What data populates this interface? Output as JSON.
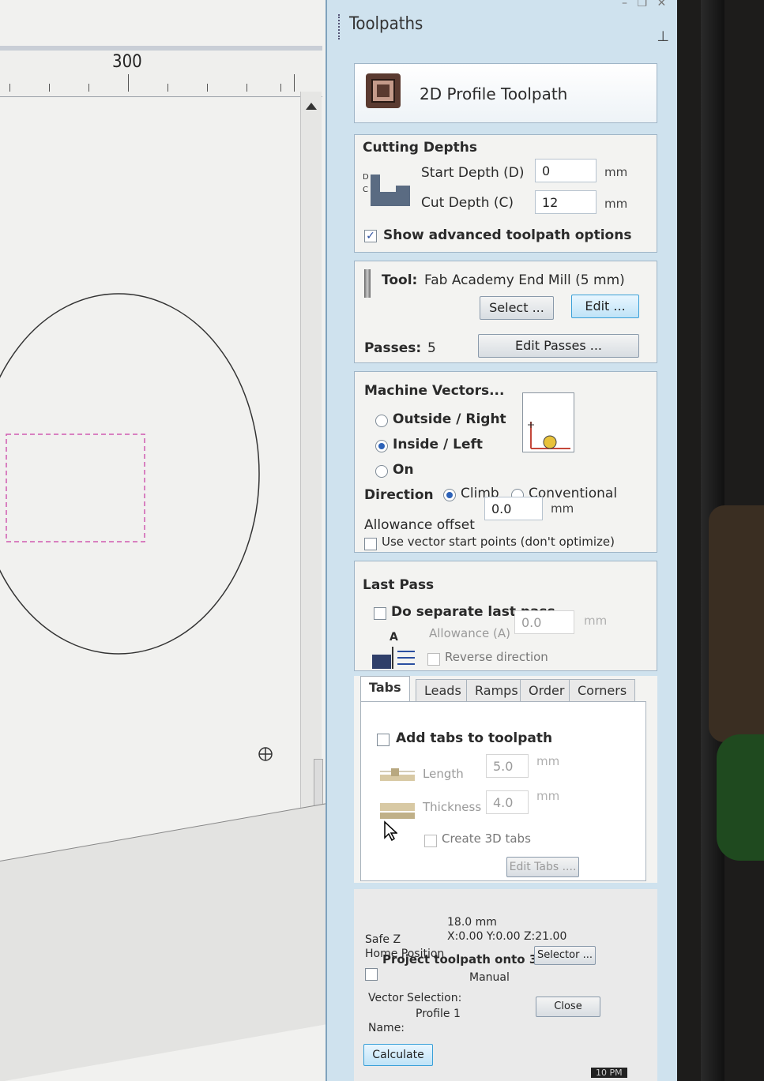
{
  "window": {
    "minimize": "–",
    "restore": "❐",
    "close": "✕"
  },
  "canvas": {
    "ruler_label": "300"
  },
  "panel": {
    "title": "Toolpaths",
    "pin_icon": "pin-icon",
    "header_title": "2D Profile Toolpath",
    "cutting_depths": {
      "heading": "Cutting Depths",
      "start_depth_label": "Start Depth (D)",
      "start_depth_value": "0",
      "start_depth_unit": "mm",
      "cut_depth_label": "Cut Depth (C)",
      "cut_depth_value": "12",
      "cut_depth_unit": "mm",
      "advanced_label": "Show advanced toolpath options",
      "advanced_checked": true,
      "diagram_d": "D",
      "diagram_c": "C"
    },
    "tool": {
      "label": "Tool:",
      "name": "Fab Academy End Mill (5 mm)",
      "select_button": "Select ...",
      "edit_button": "Edit ...",
      "passes_label": "Passes:",
      "passes_value": "5",
      "edit_passes_button": "Edit Passes ..."
    },
    "machine_vectors": {
      "heading": "Machine Vectors...",
      "outside_label": "Outside / Right",
      "inside_label": "Inside / Left",
      "on_label": "On",
      "selected": "Inside / Left",
      "direction_label": "Direction",
      "climb_label": "Climb",
      "conventional_label": "Conventional",
      "direction_selected": "Climb",
      "allowance_label": "Allowance offset",
      "allowance_value": "0.0",
      "allowance_unit": "mm",
      "vector_start_label": "Use vector start points (don't optimize)"
    },
    "last_pass": {
      "heading": "Last Pass",
      "separate_label": "Do separate last pass",
      "allowance_label": "Allowance (A)",
      "allowance_value": "0.0",
      "allowance_unit": "mm",
      "reverse_label": "Reverse direction",
      "diagram_a": "A"
    },
    "tabs": {
      "items": [
        "Tabs",
        "Leads",
        "Ramps",
        "Order",
        "Corners"
      ],
      "active": "Tabs",
      "add_tabs_label": "Add tabs to toolpath",
      "length_label": "Length",
      "length_value": "5.0",
      "length_unit": "mm",
      "thickness_label": "Thickness",
      "thickness_value": "4.0",
      "thickness_unit": "mm",
      "create_3d_label": "Create 3D tabs",
      "edit_tabs_button": "Edit Tabs ...."
    },
    "footer": {
      "safe_z_label": "Safe Z",
      "safe_z_value": "18.0 mm",
      "home_label": "Home Position",
      "home_value": "X:0.00 Y:0.00 Z:21.00",
      "project_label": "Project toolpath onto 3D model",
      "vector_selection_label": "Vector Selection:",
      "vector_selection_value": "Manual",
      "selector_button": "Selector ...",
      "name_label": "Name:",
      "name_value": "Profile 1",
      "close_button": "Close",
      "calculate_button": "Calculate"
    },
    "taskbar_time": "10 PM"
  }
}
